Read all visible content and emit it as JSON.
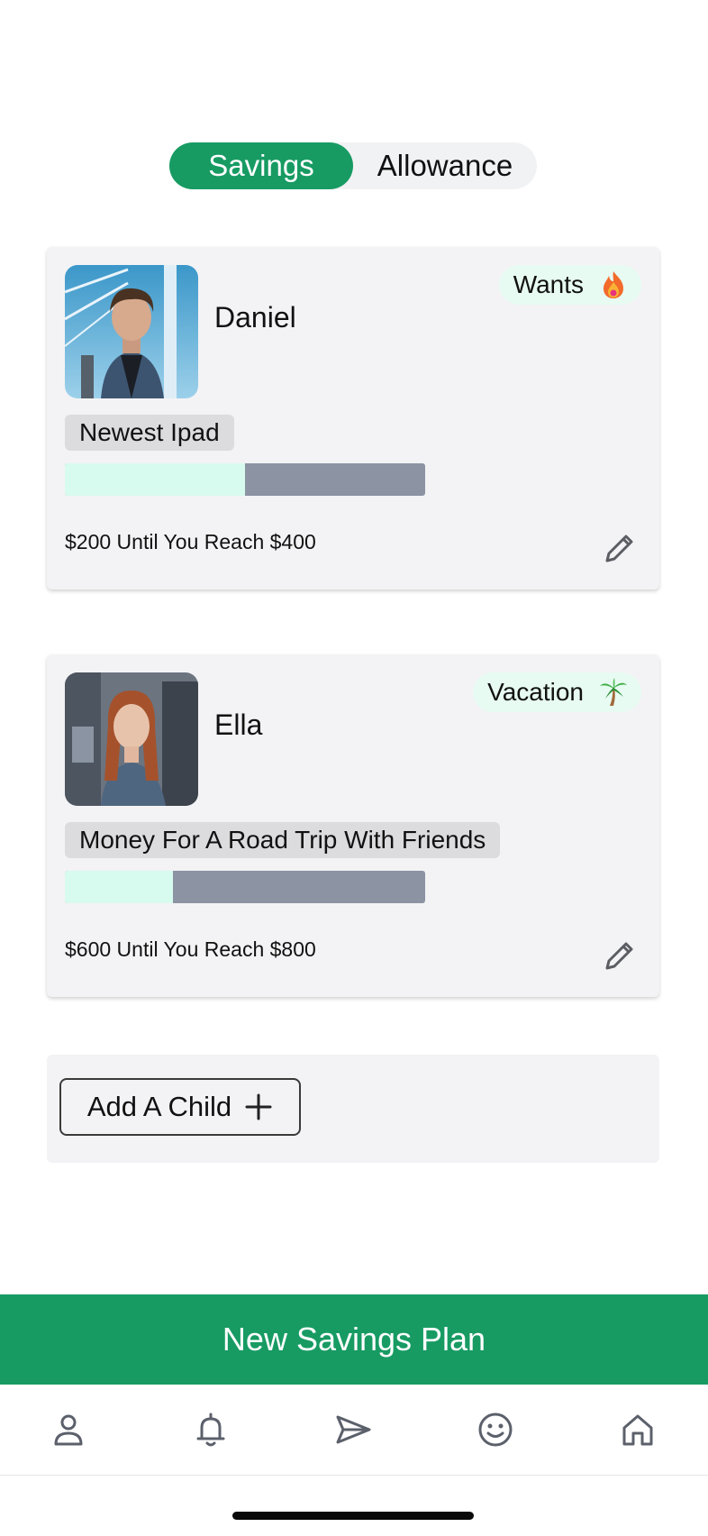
{
  "toggle": {
    "active_label": "Savings",
    "inactive_label": "Allowance"
  },
  "colors": {
    "accent": "#179b63",
    "progress_fill": "#d8fbef",
    "progress_track": "#8c93a3",
    "tag_bg": "#e7fbf2"
  },
  "plans": [
    {
      "name": "Daniel",
      "avatar_icon": "child-photo-daniel",
      "category": "Wants",
      "category_icon": "fire-icon",
      "goal": "Newest Ipad",
      "progress_fraction": 0.5,
      "progress_text": "$200 Until You Reach $400"
    },
    {
      "name": "Ella",
      "avatar_icon": "child-photo-ella",
      "category": "Vacation",
      "category_icon": "palm-tree-icon",
      "goal": "Money For A Road Trip With Friends",
      "progress_fraction": 0.3,
      "progress_text": "$600 Until You Reach $800"
    }
  ],
  "add_child": {
    "label": "Add A Child",
    "icon": "plus-icon"
  },
  "cta": {
    "label": "New Savings Plan"
  },
  "nav": {
    "items": [
      "profile-icon",
      "bell-icon",
      "send-icon",
      "smiley-icon",
      "home-icon"
    ]
  }
}
